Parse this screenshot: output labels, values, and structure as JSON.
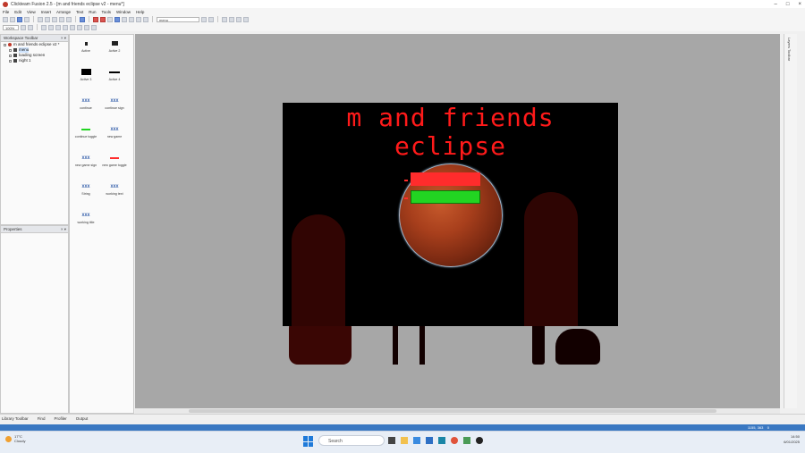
{
  "window": {
    "title": "Clickteam Fusion 2.5 - [m and friends eclipse v2 - menu*]",
    "controls": [
      "–",
      "□",
      "×"
    ]
  },
  "menu": [
    "File",
    "Edit",
    "View",
    "Insert",
    "Arrange",
    "Text",
    "Run",
    "Tools",
    "Window",
    "Help"
  ],
  "toolbar": {
    "layout_select": "menu",
    "zoom": "100%"
  },
  "workspace": {
    "header": "Workspace Toolbar",
    "items": [
      {
        "label": "m and friends eclipse v2 *"
      },
      {
        "label": "menu"
      },
      {
        "label": "loading screen"
      },
      {
        "label": "night 1"
      }
    ]
  },
  "properties": {
    "header": "Properties"
  },
  "toolbox": {
    "items": [
      {
        "icon": "",
        "label": "Active"
      },
      {
        "icon": "",
        "label": "Active 2"
      },
      {
        "icon": "",
        "label": "Active 3"
      },
      {
        "icon": "",
        "label": "Active 4"
      },
      {
        "icon": "XXX",
        "label": "continue"
      },
      {
        "icon": "XXX",
        "label": "continue sign"
      },
      {
        "icon": "",
        "label": "continue toggle"
      },
      {
        "icon": "XXX",
        "label": "new game"
      },
      {
        "icon": "XXX",
        "label": "new game sign"
      },
      {
        "icon": "",
        "label": "new game toggle"
      },
      {
        "icon": "XXX",
        "label": "String"
      },
      {
        "icon": "XXX",
        "label": "working text"
      },
      {
        "icon": "XXX",
        "label": "working title"
      }
    ]
  },
  "frame": {
    "title_line1": "m and friends",
    "title_line2": "eclipse"
  },
  "right_strip": {
    "label": "Layers Toolbar"
  },
  "bottom_tabs": [
    "Library Toolbar",
    "Find",
    "Profiler",
    "Output"
  ],
  "statusbar": {
    "coords": "1155, 363",
    "zero": "0"
  },
  "taskbar": {
    "weather_temp": "17°C",
    "weather_desc": "Cloudy",
    "search_placeholder": "Search",
    "time": "14:50",
    "date": "6/01/2025"
  },
  "colors": {
    "accent": "#3a78c2",
    "title_red": "#ff1a1a",
    "bar_red": "#ff2c2c",
    "bar_green": "#22d422"
  }
}
